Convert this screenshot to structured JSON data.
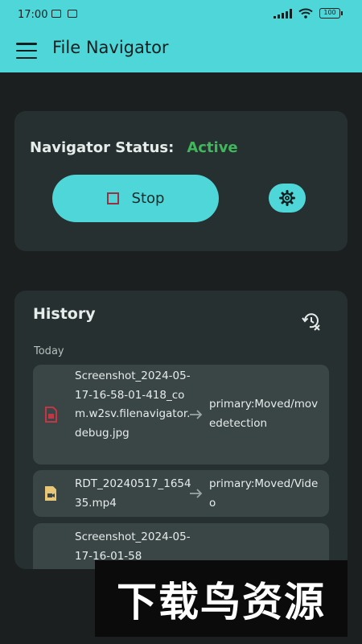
{
  "status_bar": {
    "time": "17:00",
    "battery": "100"
  },
  "app_bar": {
    "title": "File Navigator"
  },
  "status_card": {
    "label": "Navigator Status:",
    "value": "Active",
    "value_color": "#3fb85c",
    "stop_label": "Stop"
  },
  "history": {
    "title": "History",
    "day": "Today",
    "items": [
      {
        "icon": "image-file-icon",
        "name": "Screenshot_2024-05-17-16-58-01-418_com.w2sv.filenavigator.debug.jpg",
        "dest": "primary:Moved/movedetection"
      },
      {
        "icon": "video-file-icon",
        "name": "RDT_20240517_165435.mp4",
        "dest": "primary:Moved/Video"
      },
      {
        "icon": "image-file-icon",
        "name": "Screenshot_2024-05-17-16-01-58",
        "dest": ""
      }
    ]
  },
  "watermark": "下载鸟资源",
  "colors": {
    "accent": "#4fd6d8",
    "background": "#1c1f1f",
    "card": "#273030",
    "item": "#3a4646"
  }
}
